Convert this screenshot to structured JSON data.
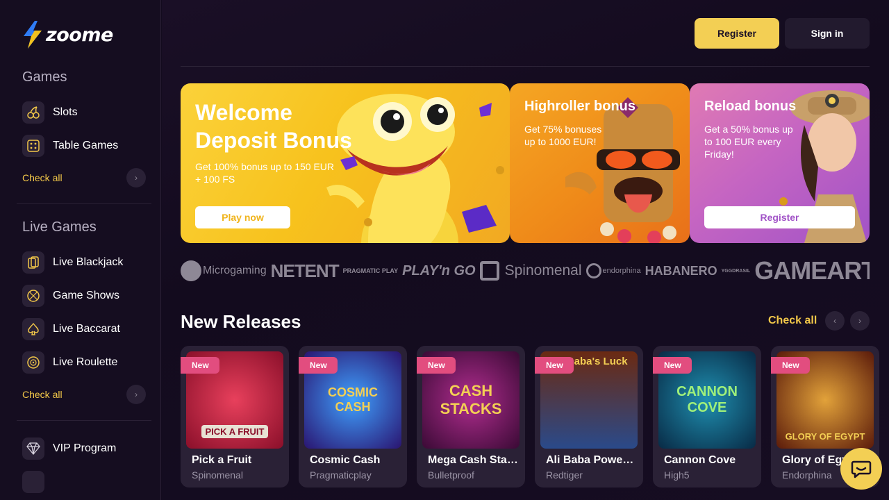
{
  "brand": {
    "name": "zoome",
    "accent": "#f3cf54"
  },
  "sidebar": {
    "games_title": "Games",
    "games_items": [
      {
        "label": "Slots",
        "icon": "cherry-icon"
      },
      {
        "label": "Table Games",
        "icon": "dice-icon"
      }
    ],
    "games_check_all": "Check all",
    "live_title": "Live Games",
    "live_items": [
      {
        "label": "Live Blackjack",
        "icon": "cards-icon"
      },
      {
        "label": "Game Shows",
        "icon": "wheel-icon"
      },
      {
        "label": "Live Baccarat",
        "icon": "spade-icon"
      },
      {
        "label": "Live Roulette",
        "icon": "roulette-icon"
      }
    ],
    "live_check_all": "Check all",
    "vip_label": "VIP Program"
  },
  "header": {
    "register_label": "Register",
    "signin_label": "Sign in"
  },
  "banners": [
    {
      "title_line1": "Welcome",
      "title_line2": "Deposit Bonus",
      "text_line1": "Get 100% bonus up to 150 EUR",
      "text_line2": "+ 100 FS",
      "button": "Play now"
    },
    {
      "title": "Highroller bonus",
      "text_line1": "Get 75% bonuses",
      "text_line2": "up to 1000 EUR!"
    },
    {
      "title": "Reload bonus",
      "text_line1": "Get a 50% bonus up",
      "text_line2": "to 100 EUR every",
      "text_line3": "Friday!",
      "button": "Register"
    }
  ],
  "providers": [
    "Microgaming",
    "NETENT",
    "PRAGMATIC PLAY",
    "PLAY'n GO",
    "Spinomenal",
    "endorphina",
    "HABANERO",
    "YGGDRASIL",
    "GAMEART"
  ],
  "new_releases": {
    "title": "New Releases",
    "check_all": "Check all",
    "badge": "New",
    "games": [
      {
        "title": "Pick a Fruit",
        "provider": "Spinomenal",
        "art": "PICK A FRUIT"
      },
      {
        "title": "Cosmic Cash",
        "provider": "Pragmaticplay",
        "art": "COSMIC CASH"
      },
      {
        "title": "Mega Cash Stacks",
        "provider": "Bulletproof",
        "art": "CASH STACKS"
      },
      {
        "title": "Ali Baba Power Reels",
        "provider": "Redtiger",
        "art": "Ali Baba's Luck"
      },
      {
        "title": "Cannon Cove",
        "provider": "High5",
        "art": "CANNON COVE"
      },
      {
        "title": "Glory of Egypt",
        "provider": "Endorphina",
        "art": "GLORY OF EGYPT"
      }
    ]
  }
}
